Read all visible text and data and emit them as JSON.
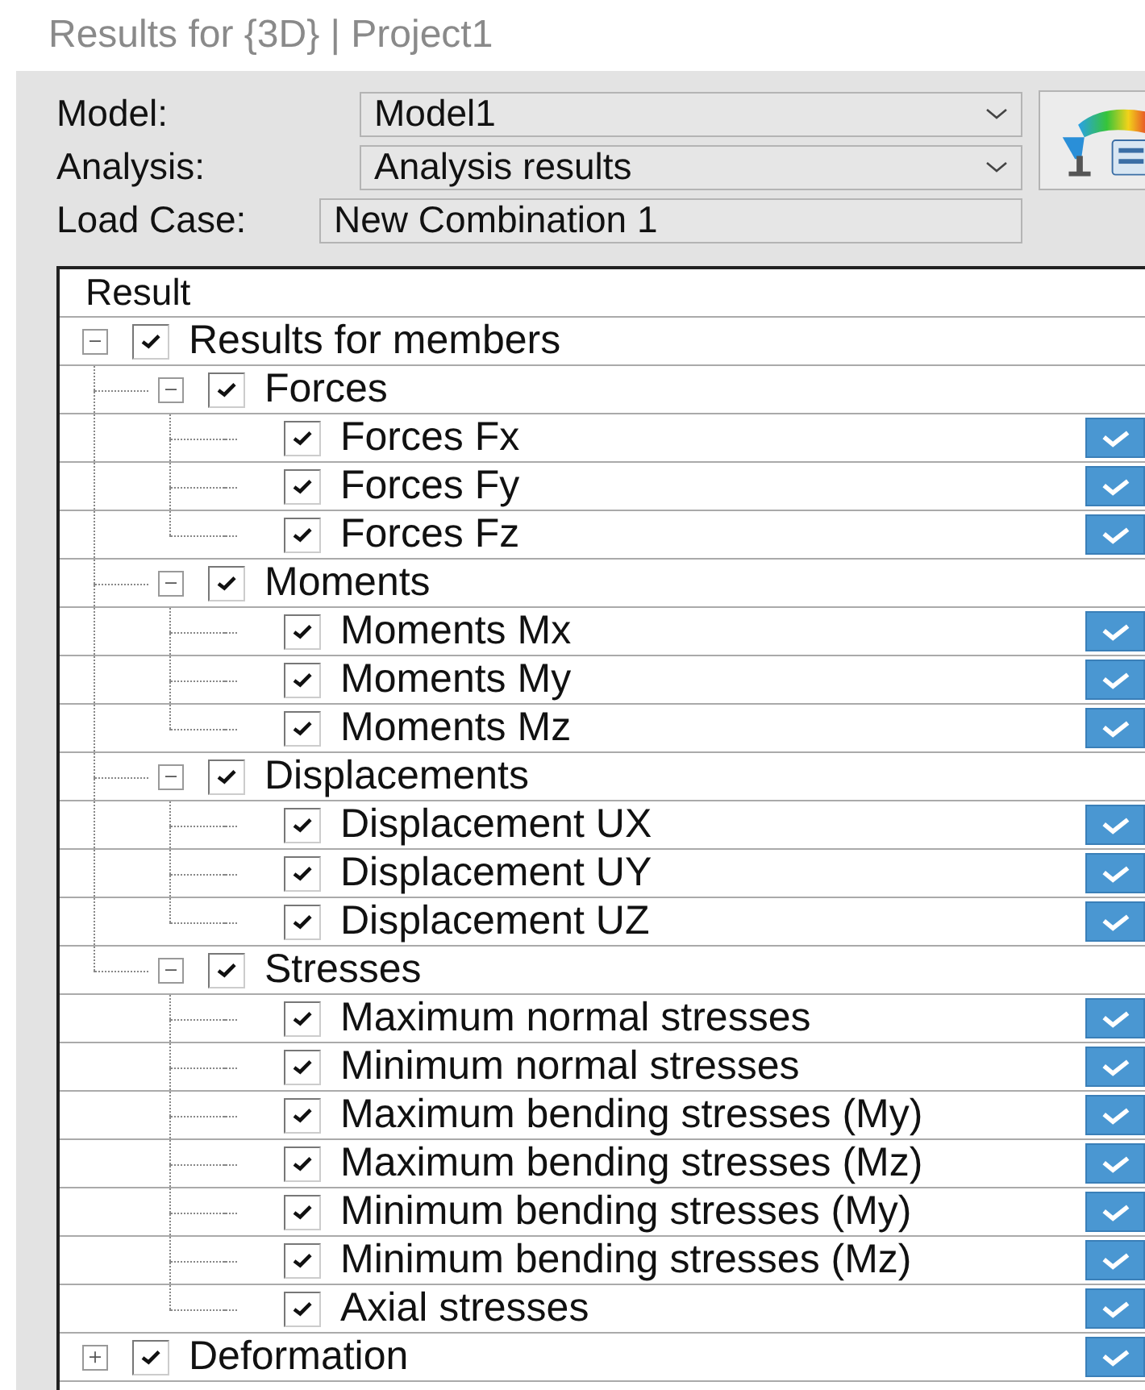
{
  "window": {
    "title": "Results for {3D} | Project1"
  },
  "fields": [
    {
      "kind": "dropdown",
      "label": "Model:",
      "value": "Model1"
    },
    {
      "kind": "dropdown",
      "label": "Analysis:",
      "value": "Analysis results"
    },
    {
      "kind": "text",
      "label": "Load Case:",
      "value": "New Combination 1"
    }
  ],
  "tree": {
    "header": "Result",
    "items": [
      {
        "label": "Results for members",
        "checked": true,
        "expanded": true,
        "display": false,
        "children": [
          {
            "label": "Forces",
            "checked": true,
            "expanded": true,
            "display": false,
            "children": [
              {
                "label": "Forces Fx",
                "checked": true,
                "display": true
              },
              {
                "label": "Forces Fy",
                "checked": true,
                "display": true
              },
              {
                "label": "Forces Fz",
                "checked": true,
                "display": true
              }
            ]
          },
          {
            "label": "Moments",
            "checked": true,
            "expanded": true,
            "display": false,
            "children": [
              {
                "label": "Moments Mx",
                "checked": true,
                "display": true
              },
              {
                "label": "Moments My",
                "checked": true,
                "display": true
              },
              {
                "label": "Moments Mz",
                "checked": true,
                "display": true
              }
            ]
          },
          {
            "label": "Displacements",
            "checked": true,
            "expanded": true,
            "display": false,
            "children": [
              {
                "label": "Displacement UX",
                "checked": true,
                "display": true
              },
              {
                "label": "Displacement UY",
                "checked": true,
                "display": true
              },
              {
                "label": "Displacement UZ",
                "checked": true,
                "display": true
              }
            ]
          },
          {
            "label": "Stresses",
            "checked": true,
            "expanded": true,
            "display": false,
            "children": [
              {
                "label": "Maximum normal stresses",
                "checked": true,
                "display": true
              },
              {
                "label": "Minimum normal stresses",
                "checked": true,
                "display": true
              },
              {
                "label": "Maximum bending stresses (My)",
                "checked": true,
                "display": true
              },
              {
                "label": "Maximum bending stresses (Mz)",
                "checked": true,
                "display": true
              },
              {
                "label": "Minimum bending stresses (My)",
                "checked": true,
                "display": true
              },
              {
                "label": "Minimum bending stresses (Mz)",
                "checked": true,
                "display": true
              },
              {
                "label": "Axial stresses",
                "checked": true,
                "display": true
              }
            ]
          }
        ]
      },
      {
        "label": "Deformation",
        "checked": true,
        "expanded": false,
        "display": true
      }
    ]
  }
}
